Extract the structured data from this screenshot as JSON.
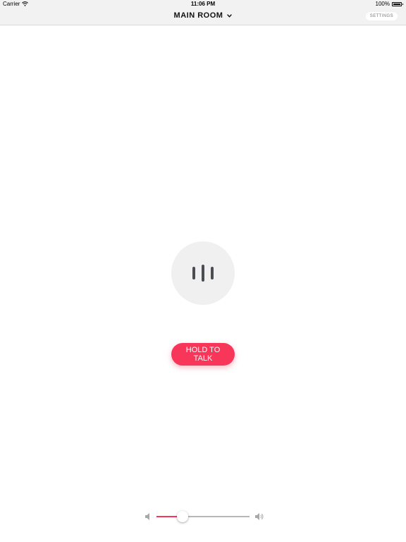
{
  "status_bar": {
    "carrier": "Carrier",
    "time": "11:06 PM",
    "battery": "100%",
    "icons": [
      "wifi-icon",
      "battery-icon"
    ]
  },
  "nav": {
    "title": "MAIN ROOM",
    "settings_label": "SETTINGS"
  },
  "main": {
    "mic_icon": "audio-bars-icon",
    "talk_label": "HOLD TO TALK"
  },
  "volume": {
    "level": 0.28,
    "icons": [
      "volume-low-icon",
      "volume-high-icon"
    ]
  },
  "colors": {
    "accent": "#f8365a",
    "circle": "#f0f0f0",
    "bar": "#f2f2f2"
  }
}
